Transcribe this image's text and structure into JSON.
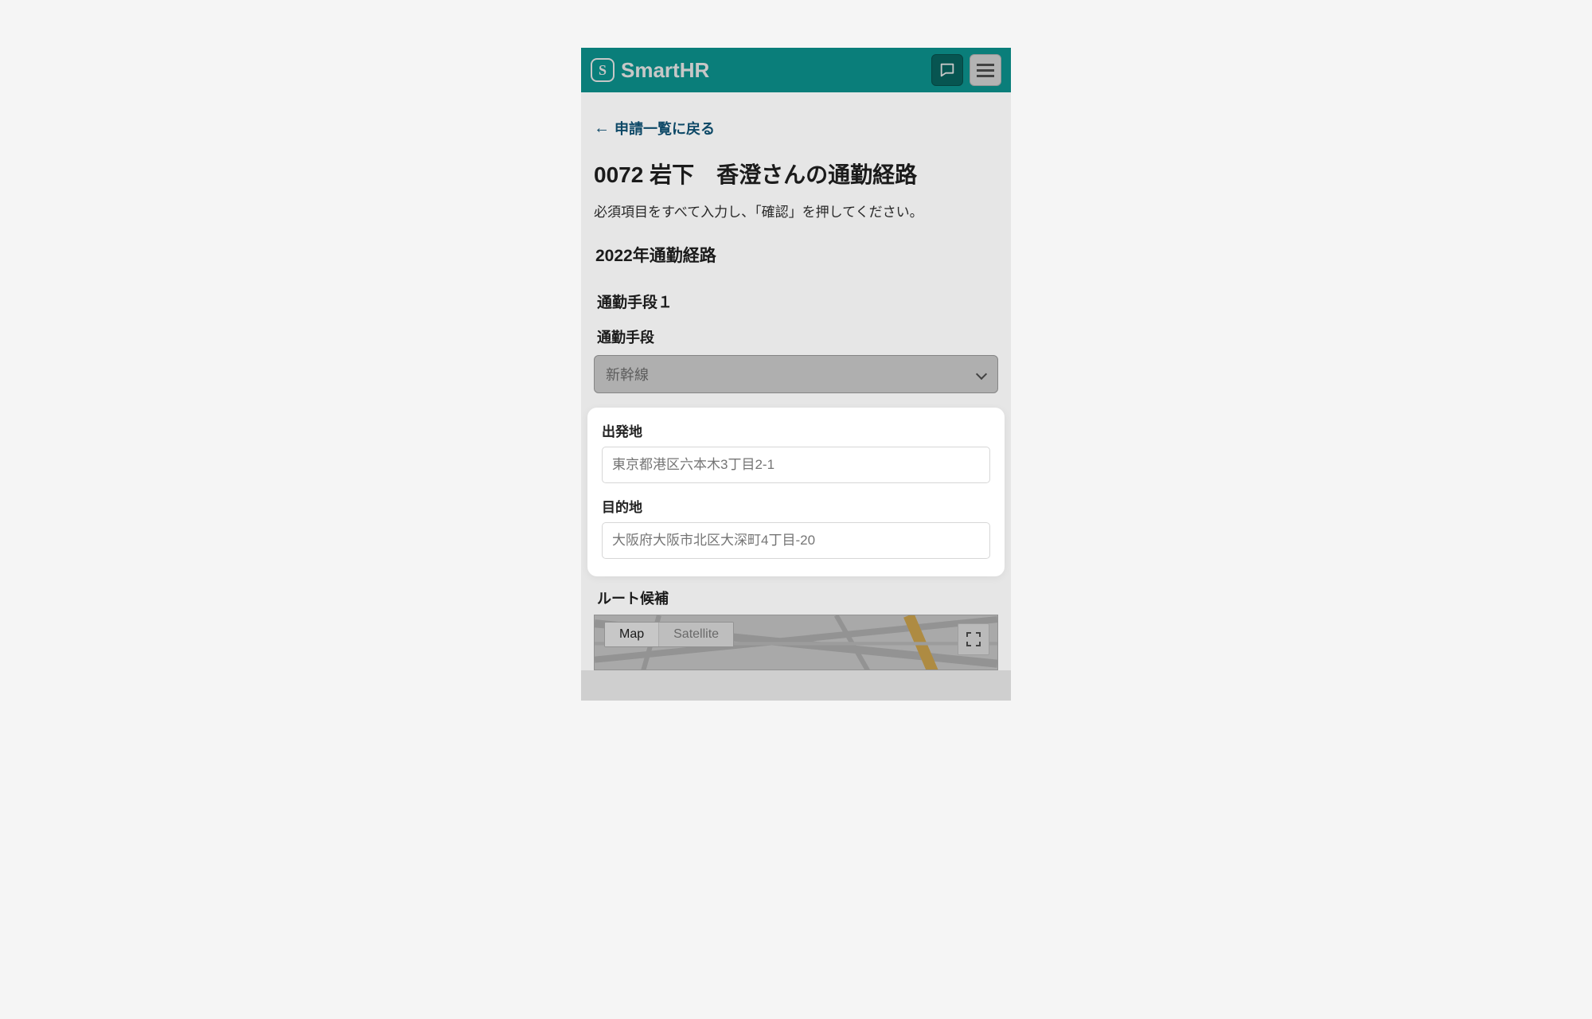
{
  "brand": {
    "name": "SmartHR",
    "logo_letter": "S"
  },
  "nav": {
    "back_label": "申請一覧に戻る"
  },
  "page": {
    "title": "0072 岩下　香澄さんの通勤経路",
    "help": "必須項目をすべて入力し、「確認」を押してください。",
    "section_title": "2022年通勤経路"
  },
  "form": {
    "group1_label": "通勤手段１",
    "means_label": "通勤手段",
    "means_value": "新幹線",
    "origin_label": "出発地",
    "origin_placeholder": "東京都港区六本木3丁目2-1",
    "dest_label": "目的地",
    "dest_placeholder": "大阪府大阪市北区大深町4丁目-20",
    "route_label": "ルート候補"
  },
  "map": {
    "tab_map": "Map",
    "tab_satellite": "Satellite"
  }
}
